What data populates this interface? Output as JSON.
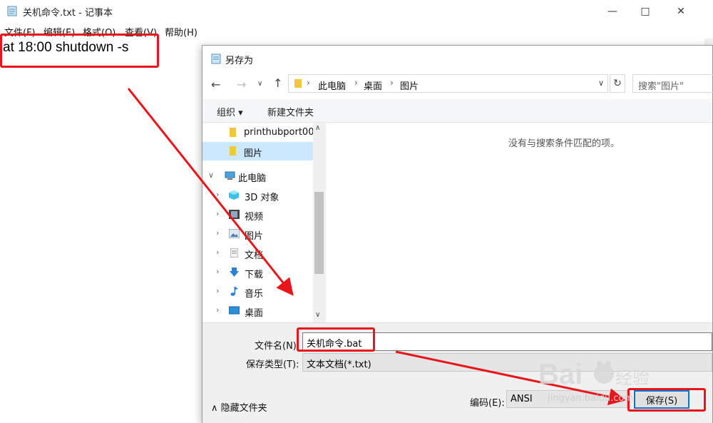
{
  "notepad": {
    "title": "关机命令.txt - 记事本",
    "menu": [
      "文件(F)",
      "编辑(E)",
      "格式(O)",
      "查看(V)",
      "帮助(H)"
    ],
    "content": "at 18:00 shutdown -s"
  },
  "dialog": {
    "title": "另存为",
    "breadcrumb": [
      "此电脑",
      "桌面",
      "图片"
    ],
    "search_placeholder": "搜索\"图片\"",
    "toolbar": {
      "organize": "组织 ▾",
      "new_folder": "新建文件夹"
    },
    "tree": [
      {
        "label": "printhubport00",
        "icon": "folder-icon",
        "indent": "child",
        "selected": false,
        "expandable": false
      },
      {
        "label": "图片",
        "icon": "folder-icon",
        "indent": "child",
        "selected": true,
        "expandable": false
      },
      {
        "label": "此电脑",
        "icon": "computer-icon",
        "indent": "root",
        "selected": false,
        "expandable": true,
        "expanded": true
      },
      {
        "label": "3D 对象",
        "icon": "3d-objects-icon",
        "indent": "child",
        "selected": false,
        "expandable": true
      },
      {
        "label": "视频",
        "icon": "video-icon",
        "indent": "child",
        "selected": false,
        "expandable": true
      },
      {
        "label": "图片",
        "icon": "pictures-icon",
        "indent": "child",
        "selected": false,
        "expandable": true
      },
      {
        "label": "文档",
        "icon": "documents-icon",
        "indent": "child",
        "selected": false,
        "expandable": true
      },
      {
        "label": "下载",
        "icon": "download-icon",
        "indent": "child",
        "selected": false,
        "expandable": true
      },
      {
        "label": "音乐",
        "icon": "music-icon",
        "indent": "child",
        "selected": false,
        "expandable": true
      },
      {
        "label": "桌面",
        "icon": "desktop-icon",
        "indent": "child",
        "selected": false,
        "expandable": true
      }
    ],
    "empty_message": "没有与搜索条件匹配的项。",
    "filename_label": "文件名(N):",
    "filename_value": "关机命令.bat",
    "filetype_label": "保存类型(T):",
    "filetype_value": "文本文档(*.txt)",
    "hide_folders": "隐藏文件夹",
    "encoding_label": "编码(E):",
    "encoding_value": "ANSI",
    "save_button": "保存(S)"
  },
  "watermark": {
    "brand": "Baidu 经验",
    "url": "jingyan.baidu.com"
  },
  "colors": {
    "annotation_red": "#e8161b",
    "selection_blue": "#cce8ff",
    "accent_blue": "#0078d7"
  }
}
